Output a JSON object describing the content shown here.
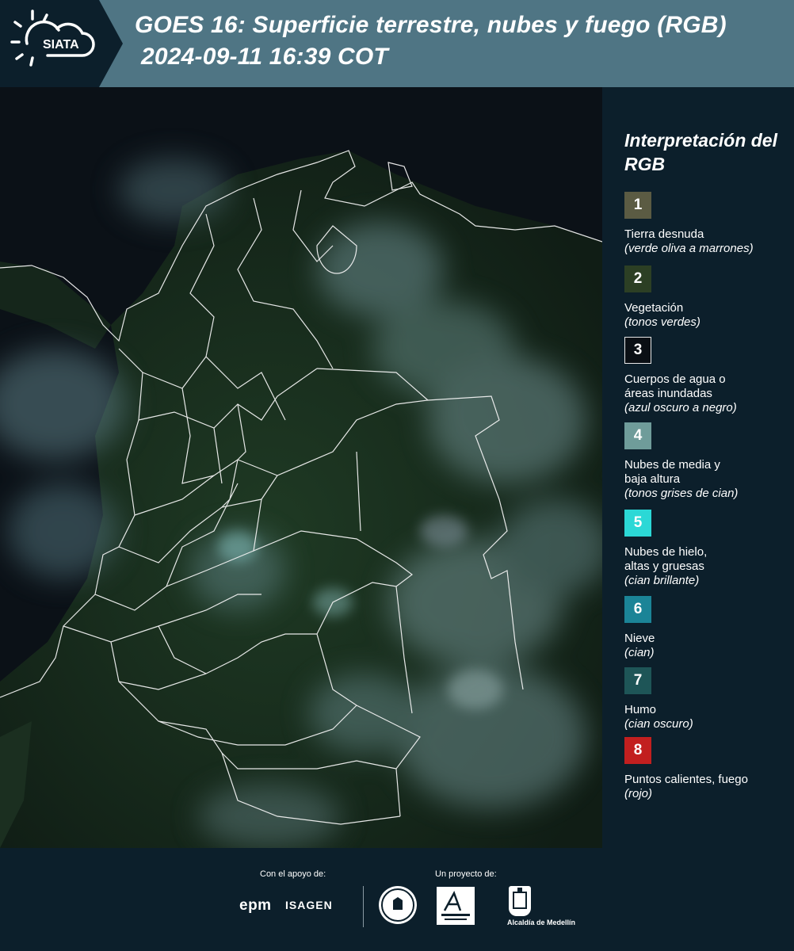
{
  "header": {
    "logo_text": "SIATA",
    "title_line1": "GOES 16: Superficie terrestre, nubes y fuego (RGB)",
    "title_line2": "2024-09-11 16:39 COT",
    "background_color": "#4f7584",
    "logo_background_color": "#0c1f2b"
  },
  "legend": {
    "title": "Interpretación del RGB",
    "items": [
      {
        "number": "1",
        "label": "Tierra desnuda",
        "note": "(verde oliva a marrones)",
        "color": "#5b5b43"
      },
      {
        "number": "2",
        "label": "Vegetación",
        "note": "(tonos verdes)",
        "color": "#2c3f24"
      },
      {
        "number": "3",
        "label": "Cuerpos de agua o\náreas inundadas",
        "note": "(azul oscuro a negro)",
        "color": "#0a0f14"
      },
      {
        "number": "4",
        "label": "Nubes de media y\nbaja altura",
        "note": "(tonos grises de cian)",
        "color": "#6f9c9a"
      },
      {
        "number": "5",
        "label": "Nubes de hielo,\naltas y gruesas",
        "note": "(cian brillante)",
        "color": "#2bd8d6"
      },
      {
        "number": "6",
        "label": "Nieve",
        "note": "(cian)",
        "color": "#1b8497"
      },
      {
        "number": "7",
        "label": "Humo",
        "note": "(cian oscuro)",
        "color": "#1e5557"
      },
      {
        "number": "8",
        "label": "Puntos calientes, fuego",
        "note": "(rojo)",
        "color": "#c21f1f"
      }
    ]
  },
  "footer": {
    "support_caption": "Con el apoyo de:",
    "project_caption": "Un proyecto de:",
    "sponsor_epm": "epm",
    "sponsor_isagen": "ISAGEN",
    "alcaldia": "Alcaldía de Medellín"
  }
}
